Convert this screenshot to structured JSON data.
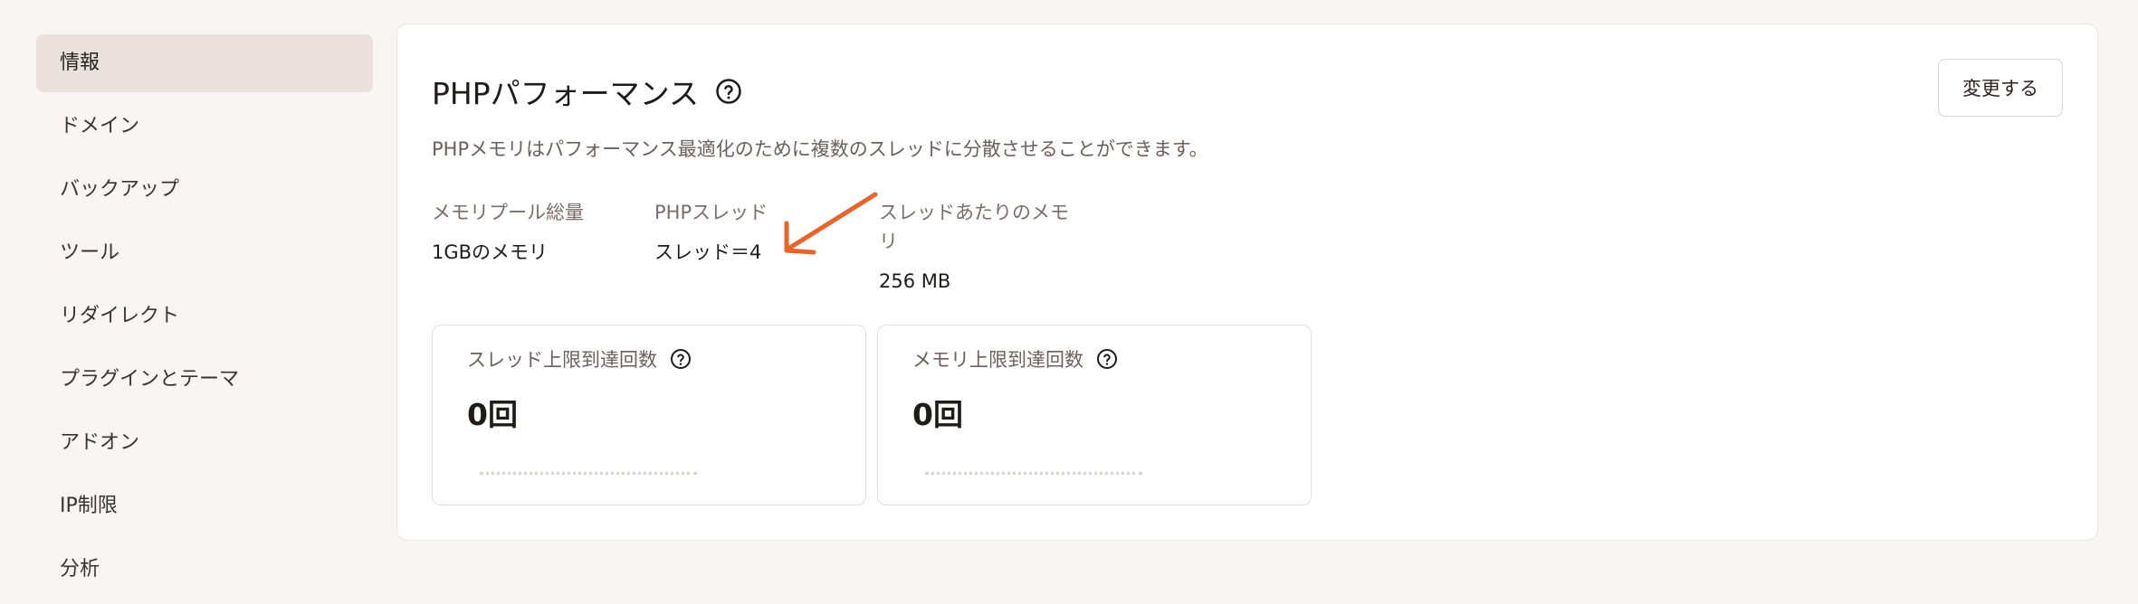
{
  "sidebar": {
    "items": [
      {
        "label": "情報",
        "active": true
      },
      {
        "label": "ドメイン"
      },
      {
        "label": "バックアップ"
      },
      {
        "label": "ツール"
      },
      {
        "label": "リダイレクト"
      },
      {
        "label": "プラグインとテーマ"
      },
      {
        "label": "アドオン"
      },
      {
        "label": "IP制限"
      },
      {
        "label": "分析"
      }
    ]
  },
  "card": {
    "title": "PHPパフォーマンス",
    "help_icon": "help-circle-icon",
    "change_button": "変更する",
    "description": "PHPメモリはパフォーマンス最適化のために複数のスレッドに分散させることができます。",
    "stats": {
      "pool": {
        "label": "メモリプール総量",
        "value": "1GBのメモリ"
      },
      "threads": {
        "label": "PHPスレッド",
        "value": "スレッド＝4"
      },
      "per_thread": {
        "label": "スレッドあたりのメモリ",
        "value": "256 MB"
      }
    },
    "metrics": {
      "threads_limit": {
        "label": "スレッド上限到達回数",
        "value": "0回"
      },
      "memory_limit": {
        "label": "メモリ上限到達回数",
        "value": "0回"
      }
    },
    "annotation_arrow_color": "#e8642c"
  }
}
